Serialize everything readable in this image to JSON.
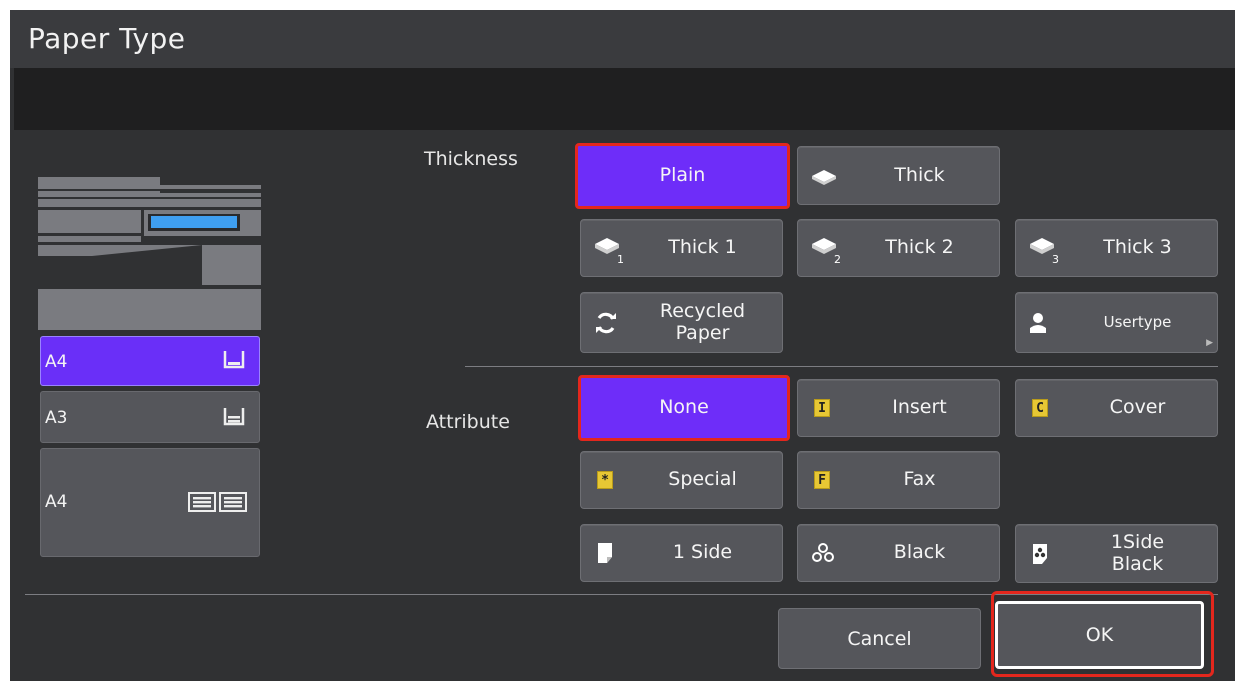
{
  "window": {
    "title": "Paper Type",
    "message": ""
  },
  "trays": [
    {
      "label": "A4",
      "selected": true,
      "icon": "tray-icon"
    },
    {
      "label": "A3",
      "selected": false,
      "icon": "tray-icon"
    },
    {
      "label": "A4",
      "selected": false,
      "icon": "large-capacity-tray-icon"
    }
  ],
  "thickness": {
    "label": "Thickness",
    "buttons": [
      {
        "label": "Plain",
        "selected": true,
        "icon": ""
      },
      {
        "label": "Thick",
        "selected": false,
        "icon": "paper-stack-icon"
      },
      {
        "label": "Thick 1",
        "selected": false,
        "icon": "paper-stack-icon",
        "sub": "1"
      },
      {
        "label": "Thick 2",
        "selected": false,
        "icon": "paper-stack-icon",
        "sub": "2"
      },
      {
        "label": "Thick 3",
        "selected": false,
        "icon": "paper-stack-icon",
        "sub": "3"
      },
      {
        "label": "Recycled Paper",
        "selected": false,
        "icon": "recycle-icon"
      },
      {
        "label": "Usertype",
        "selected": false,
        "icon": "user-icon"
      }
    ]
  },
  "attribute": {
    "label": "Attribute",
    "buttons": [
      {
        "label": "None",
        "selected": true,
        "icon": ""
      },
      {
        "label": "Insert",
        "selected": false,
        "icon": "insert-icon",
        "tag": "I"
      },
      {
        "label": "Cover",
        "selected": false,
        "icon": "cover-icon",
        "tag": "C"
      },
      {
        "label": "Special",
        "selected": false,
        "icon": "special-icon",
        "tag": "*"
      },
      {
        "label": "Fax",
        "selected": false,
        "icon": "fax-icon",
        "tag": "F"
      },
      {
        "label": "1 Side",
        "selected": false,
        "icon": "one-side-icon"
      },
      {
        "label": "Black",
        "selected": false,
        "icon": "black-icon"
      },
      {
        "label": "1Side Black",
        "selected": false,
        "icon": "one-side-black-icon"
      }
    ]
  },
  "footer": {
    "cancel_label": "Cancel",
    "ok_label": "OK"
  },
  "colors": {
    "background": "#303133",
    "selected": "#6e2df9",
    "highlight": "#e3271d",
    "tag": "#e7c734"
  }
}
